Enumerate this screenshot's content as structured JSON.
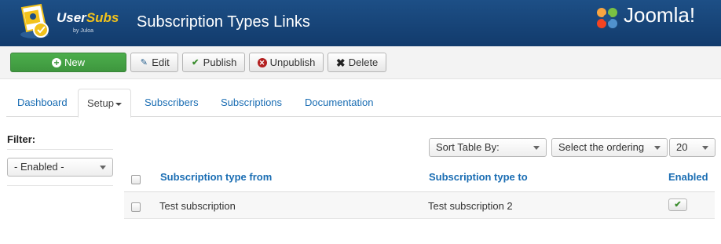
{
  "header": {
    "logo_text_user": "User",
    "logo_text_subs": "Subs",
    "logo_by": "by Juloa",
    "title": "Subscription Types Links",
    "joomla_text": "Joomla!"
  },
  "toolbar": {
    "new_label": "New",
    "edit_label": "Edit",
    "publish_label": "Publish",
    "unpublish_label": "Unpublish",
    "delete_label": "Delete"
  },
  "tabs": [
    {
      "label": "Dashboard"
    },
    {
      "label": "Setup"
    },
    {
      "label": "Subscribers"
    },
    {
      "label": "Subscriptions"
    },
    {
      "label": "Documentation"
    }
  ],
  "filter": {
    "title": "Filter:",
    "enabled_value": "- Enabled -"
  },
  "list_controls": {
    "sort_value": "Sort Table By:",
    "ordering_value": "Select the ordering",
    "limit_value": "20"
  },
  "table": {
    "columns": [
      "Subscription type from",
      "Subscription type to",
      "Enabled"
    ],
    "rows": [
      {
        "from": "Test subscription",
        "to": "Test subscription 2",
        "enabled": true
      }
    ]
  },
  "colors": {
    "header_bg": "#1a4a80",
    "new_button": "#45a845",
    "link": "#1a6db3",
    "logo_accent": "#f2c21b"
  }
}
